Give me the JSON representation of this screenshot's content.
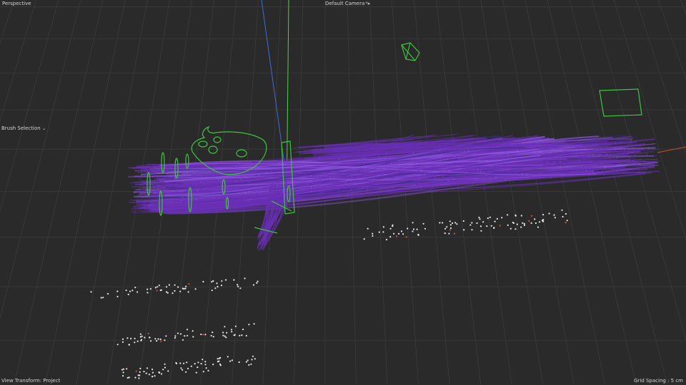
{
  "viewport": {
    "view_name": "Perspective",
    "camera_name": "Default Camera",
    "camera_menu_glyph": "*▸",
    "brush_selection": "Brush Selection",
    "brush_selection_glyph": "⌄",
    "view_transform": "View Transform: Project",
    "grid_spacing": "Grid Spacing : 5 cm"
  },
  "colors": {
    "background": "#2a2a2a",
    "grid_line": "#3b3b3b",
    "hair": "#6a2fb5",
    "hair_highlight": "#8f5ae0",
    "guide": "#3ec53e",
    "axis_y": "#4cd24c",
    "axis_z": "#3d6ed8",
    "axis_x": "#c0532e",
    "particle": "#e8e8e8"
  }
}
